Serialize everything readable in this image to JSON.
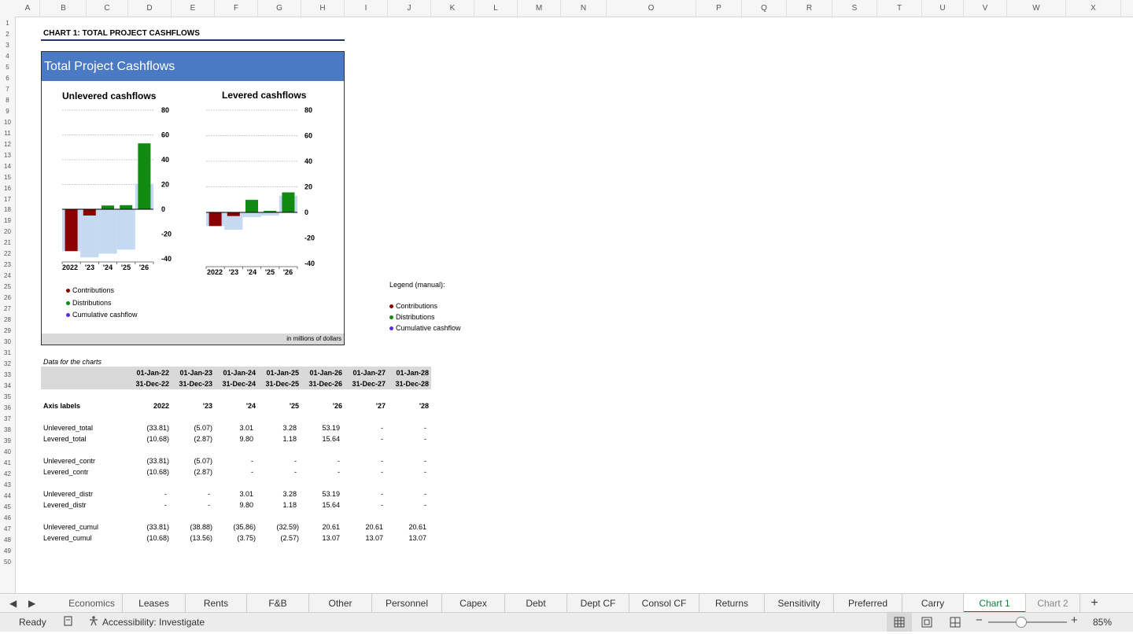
{
  "columns": [
    "A",
    "B",
    "C",
    "D",
    "E",
    "F",
    "G",
    "H",
    "I",
    "J",
    "K",
    "L",
    "M",
    "N",
    "O",
    "P",
    "Q",
    "R",
    "S",
    "T",
    "U",
    "V",
    "W",
    "X"
  ],
  "rows": [
    "1",
    "2",
    "3",
    "4",
    "5",
    "6",
    "7",
    "8",
    "9",
    "10",
    "11",
    "12",
    "13",
    "14",
    "15",
    "16",
    "17",
    "18",
    "19",
    "20",
    "21",
    "22",
    "23",
    "24",
    "25",
    "26",
    "27",
    "28",
    "29",
    "30",
    "31",
    "32",
    "33",
    "34",
    "35",
    "36",
    "37",
    "38",
    "39",
    "40",
    "41",
    "42",
    "43",
    "44",
    "45",
    "46",
    "47",
    "48",
    "49",
    "50"
  ],
  "sheet_heading": "CHART 1: TOTAL PROJECT CASHFLOWS",
  "chart_data": [
    {
      "type": "bar",
      "title": "Unlevered cashflows",
      "banner": "Total Project Cashflows",
      "categories": [
        "2022",
        "'23",
        "'24",
        "'25",
        "'26"
      ],
      "series": [
        {
          "name": "Contributions",
          "color": "#8b0000",
          "values": [
            -33.81,
            -5.07,
            0,
            0,
            0
          ]
        },
        {
          "name": "Distributions",
          "color": "#108a10",
          "values": [
            0,
            0,
            3.01,
            3.28,
            53.19
          ]
        },
        {
          "name": "Cumulative cashflow",
          "color": "#c5d9f1",
          "values": [
            -33.81,
            -38.88,
            -35.86,
            -32.59,
            20.61
          ]
        }
      ],
      "yticks": [
        "80",
        "60",
        "40",
        "20",
        "0",
        "-20",
        "-40"
      ],
      "ylim": [
        -40,
        80
      ]
    },
    {
      "type": "bar",
      "title": "Levered cashflows",
      "categories": [
        "2022",
        "'23",
        "'24",
        "'25",
        "'26"
      ],
      "series": [
        {
          "name": "Contributions",
          "color": "#8b0000",
          "values": [
            -10.68,
            -2.87,
            0,
            0,
            0
          ]
        },
        {
          "name": "Distributions",
          "color": "#108a10",
          "values": [
            0,
            0,
            9.8,
            1.18,
            15.64
          ]
        },
        {
          "name": "Cumulative cashflow",
          "color": "#c5d9f1",
          "values": [
            -10.68,
            -13.56,
            -3.75,
            -2.57,
            13.07
          ]
        }
      ],
      "yticks": [
        "80",
        "60",
        "40",
        "20",
        "0",
        "-20",
        "-40"
      ],
      "ylim": [
        -40,
        80
      ]
    }
  ],
  "chart_legend": [
    {
      "label": "Contributions",
      "color": "#8b0000"
    },
    {
      "label": "Distributions",
      "color": "#108a10"
    },
    {
      "label": "Cumulative cashflow",
      "color": "#5a2be2"
    }
  ],
  "chart_footer": "in millions of dollars",
  "manual_legend": {
    "title": "Legend (manual):",
    "items": [
      {
        "label": "Contributions",
        "color": "#8b0000"
      },
      {
        "label": "Distributions",
        "color": "#108a10"
      },
      {
        "label": "Cumulative cashflow",
        "color": "#5a2be2"
      }
    ]
  },
  "data_table": {
    "caption": "Data for the charts",
    "start_dates": [
      "01-Jan-22",
      "01-Jan-23",
      "01-Jan-24",
      "01-Jan-25",
      "01-Jan-26",
      "01-Jan-27",
      "01-Jan-28"
    ],
    "end_dates": [
      "31-Dec-22",
      "31-Dec-23",
      "31-Dec-24",
      "31-Dec-25",
      "31-Dec-26",
      "31-Dec-27",
      "31-Dec-28"
    ],
    "axis_labels_title": "Axis labels",
    "axis_labels": [
      "2022",
      "'23",
      "'24",
      "'25",
      "'26",
      "'27",
      "'28"
    ],
    "rows": [
      {
        "label": "Unlevered_total",
        "values": [
          "(33.81)",
          "(5.07)",
          "3.01",
          "3.28",
          "53.19",
          "-",
          "-"
        ]
      },
      {
        "label": "Levered_total",
        "values": [
          "(10.68)",
          "(2.87)",
          "9.80",
          "1.18",
          "15.64",
          "-",
          "-"
        ]
      },
      {
        "label": "Unlevered_contr",
        "values": [
          "(33.81)",
          "(5.07)",
          "-",
          "-",
          "-",
          "-",
          "-"
        ]
      },
      {
        "label": "Levered_contr",
        "values": [
          "(10.68)",
          "(2.87)",
          "-",
          "-",
          "-",
          "-",
          "-"
        ]
      },
      {
        "label": "Unlevered_distr",
        "values": [
          "-",
          "-",
          "3.01",
          "3.28",
          "53.19",
          "-",
          "-"
        ]
      },
      {
        "label": "Levered_distr",
        "values": [
          "-",
          "-",
          "9.80",
          "1.18",
          "15.64",
          "-",
          "-"
        ]
      },
      {
        "label": "Unlevered_cumul",
        "values": [
          "(33.81)",
          "(38.88)",
          "(35.86)",
          "(32.59)",
          "20.61",
          "20.61",
          "20.61"
        ]
      },
      {
        "label": "Levered_cumul",
        "values": [
          "(10.68)",
          "(13.56)",
          "(3.75)",
          "(2.57)",
          "13.07",
          "13.07",
          "13.07"
        ]
      }
    ]
  },
  "tabs": [
    "Economics",
    "Leases",
    "Rents",
    "F&B",
    "Other",
    "Personnel",
    "Capex",
    "Debt",
    "Dept CF",
    "Consol CF",
    "Returns",
    "Sensitivity",
    "Preferred",
    "Carry",
    "Chart 1",
    "Chart 2"
  ],
  "active_tab": "Chart 1",
  "add_sheet": "+",
  "status": {
    "ready": "Ready",
    "accessibility": "Accessibility: Investigate",
    "zoom": "85%",
    "zoom_level": 0.85
  },
  "icons": [
    "prev-sheet-icon",
    "next-sheet-icon",
    "macro-record-icon",
    "accessibility-icon",
    "normal-view-icon",
    "page-layout-view-icon",
    "page-break-view-icon",
    "zoom-out-icon",
    "zoom-in-icon"
  ]
}
